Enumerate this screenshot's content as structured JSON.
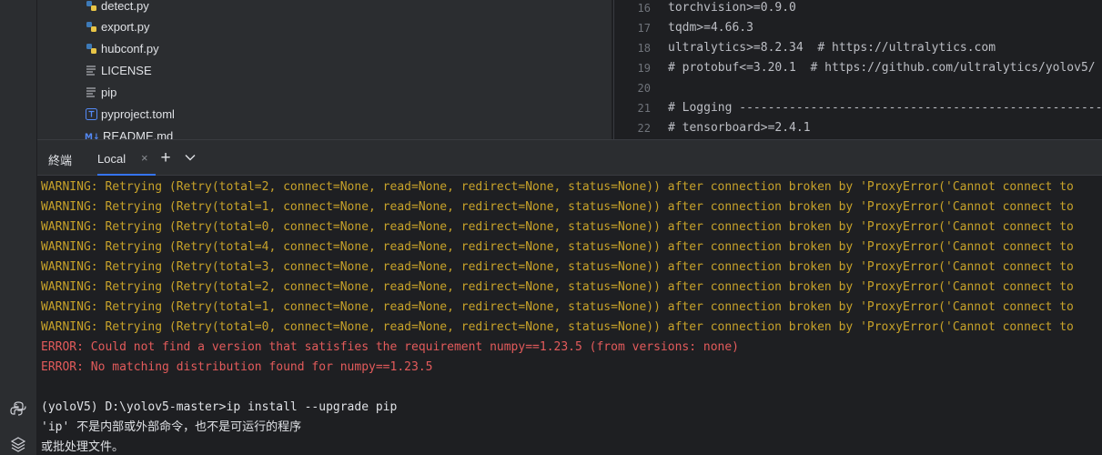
{
  "project_tree": {
    "items": [
      {
        "name": "detect.py",
        "icon": "python-file-icon"
      },
      {
        "name": "export.py",
        "icon": "python-file-icon"
      },
      {
        "name": "hubconf.py",
        "icon": "python-file-icon"
      },
      {
        "name": "LICENSE",
        "icon": "text-file-icon"
      },
      {
        "name": "pip",
        "icon": "text-file-icon"
      },
      {
        "name": "pyproject.toml",
        "icon": "toml-file-icon"
      },
      {
        "name": "README.md",
        "icon": "markdown-file-icon"
      }
    ]
  },
  "editor": {
    "lines": [
      {
        "num": "16",
        "text": "torchvision>=0.9.0"
      },
      {
        "num": "17",
        "text": "tqdm>=4.66.3"
      },
      {
        "num": "18",
        "text": "ultralytics>=8.2.34  # https://ultralytics.com"
      },
      {
        "num": "19",
        "text": "# protobuf<=3.20.1  # https://github.com/ultralytics/yolov5/"
      },
      {
        "num": "20",
        "text": ""
      },
      {
        "num": "21",
        "text": "# Logging --------------------------------------------------------"
      },
      {
        "num": "22",
        "text": "# tensorboard>=2.4.1"
      }
    ]
  },
  "terminal": {
    "title": "終端",
    "tab_label": "Local",
    "tab_close": "×",
    "add_label": "+",
    "lines": [
      {
        "kind": "warn",
        "text": "WARNING: Retrying (Retry(total=2, connect=None, read=None, redirect=None, status=None)) after connection broken by 'ProxyError('Cannot connect to"
      },
      {
        "kind": "warn",
        "text": "WARNING: Retrying (Retry(total=1, connect=None, read=None, redirect=None, status=None)) after connection broken by 'ProxyError('Cannot connect to"
      },
      {
        "kind": "warn",
        "text": "WARNING: Retrying (Retry(total=0, connect=None, read=None, redirect=None, status=None)) after connection broken by 'ProxyError('Cannot connect to"
      },
      {
        "kind": "warn",
        "text": "WARNING: Retrying (Retry(total=4, connect=None, read=None, redirect=None, status=None)) after connection broken by 'ProxyError('Cannot connect to"
      },
      {
        "kind": "warn",
        "text": "WARNING: Retrying (Retry(total=3, connect=None, read=None, redirect=None, status=None)) after connection broken by 'ProxyError('Cannot connect to"
      },
      {
        "kind": "warn",
        "text": "WARNING: Retrying (Retry(total=2, connect=None, read=None, redirect=None, status=None)) after connection broken by 'ProxyError('Cannot connect to"
      },
      {
        "kind": "warn",
        "text": "WARNING: Retrying (Retry(total=1, connect=None, read=None, redirect=None, status=None)) after connection broken by 'ProxyError('Cannot connect to"
      },
      {
        "kind": "warn",
        "text": "WARNING: Retrying (Retry(total=0, connect=None, read=None, redirect=None, status=None)) after connection broken by 'ProxyError('Cannot connect to"
      },
      {
        "kind": "err",
        "text": "ERROR: Could not find a version that satisfies the requirement numpy==1.23.5 (from versions: none)"
      },
      {
        "kind": "err",
        "text": "ERROR: No matching distribution found for numpy==1.23.5"
      },
      {
        "kind": "norm",
        "text": ""
      },
      {
        "kind": "norm",
        "text": "(yoloV5) D:\\yolov5-master>ip install --upgrade pip"
      },
      {
        "kind": "norm",
        "text": "'ip' 不是内部或外部命令，也不是可运行的程序"
      },
      {
        "kind": "norm",
        "text": "或批处理文件。"
      }
    ]
  },
  "colors": {
    "warning": "#c7a22a",
    "error": "#e35b5b",
    "accent": "#3574f0",
    "python_icon": "#3d7ab8"
  }
}
